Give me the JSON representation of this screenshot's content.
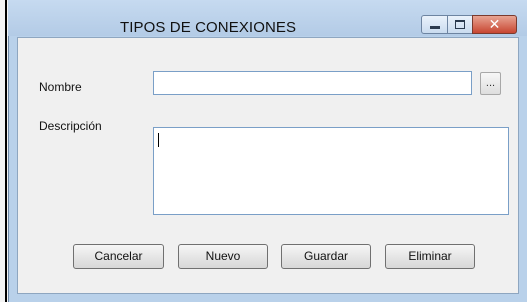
{
  "window": {
    "title": "TIPOS DE CONEXIONES",
    "controls": {
      "minimize_icon": "minimize-icon",
      "maximize_icon": "maximize-icon",
      "close_icon": "close-icon",
      "close_glyph": "✕"
    }
  },
  "form": {
    "nombre_label": "Nombre",
    "nombre_value": "",
    "browse_label": "...",
    "descripcion_label": "Descripción",
    "descripcion_value": ""
  },
  "buttons": {
    "cancelar": "Cancelar",
    "nuevo": "Nuevo",
    "guardar": "Guardar",
    "eliminar": "Eliminar"
  },
  "colors": {
    "frame": "#b9d1ea",
    "client_bg": "#f0f0f0",
    "close_button": "#c74631",
    "field_border": "#7a9fc7"
  }
}
